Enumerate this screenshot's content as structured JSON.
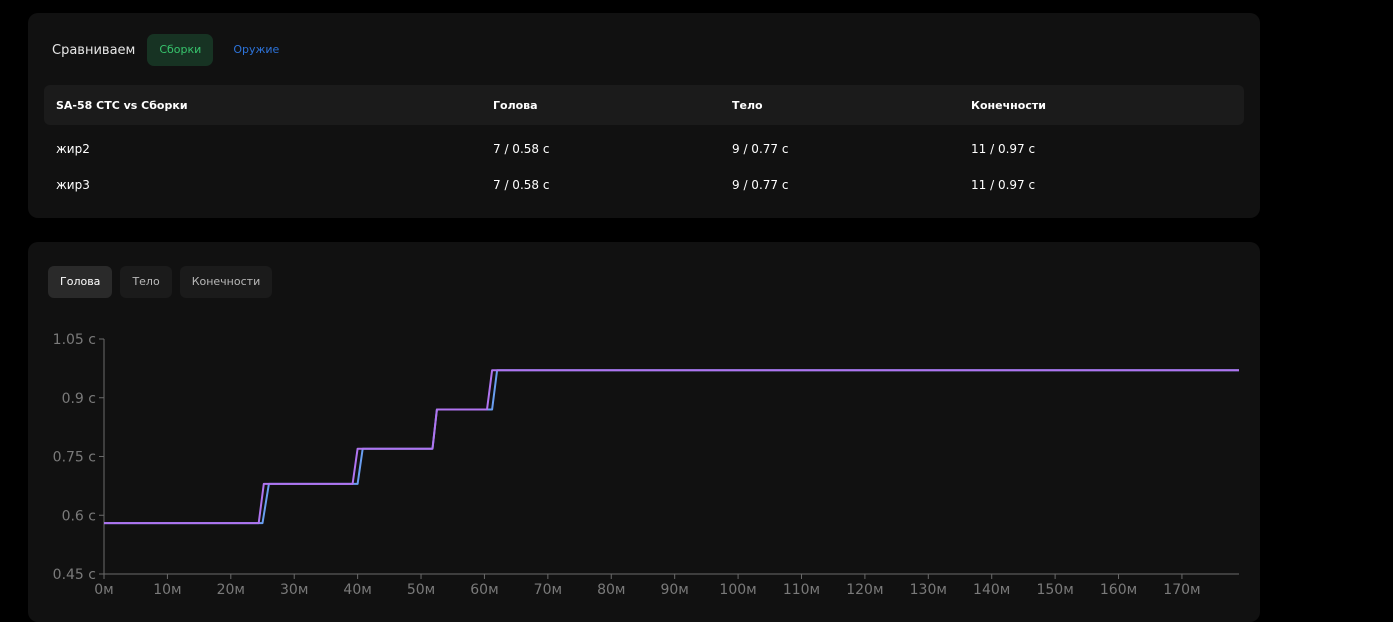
{
  "compare": {
    "label": "Сравниваем",
    "tabs": [
      {
        "label": "Сборки",
        "active": true
      },
      {
        "label": "Оружие",
        "active": false
      }
    ]
  },
  "table": {
    "headers": [
      "SA-58 СТС vs Сборки",
      "Голова",
      "Тело",
      "Конечности"
    ],
    "rows": [
      [
        "жир2",
        "7 / 0.58 с",
        "9 / 0.77 с",
        "11 / 0.97 с"
      ],
      [
        "жир3",
        "7 / 0.58 с",
        "9 / 0.77 с",
        "11 / 0.97 с"
      ]
    ]
  },
  "chart_tabs": [
    {
      "label": "Голова",
      "active": true
    },
    {
      "label": "Тело",
      "active": false
    },
    {
      "label": "Конечности",
      "active": false
    }
  ],
  "chart_data": {
    "type": "line",
    "title": "",
    "xlabel": "",
    "ylabel": "",
    "xlim": [
      0,
      179
    ],
    "ylim": [
      0.45,
      1.05
    ],
    "x_ticks": [
      "0м",
      "10м",
      "20м",
      "30м",
      "40м",
      "50м",
      "60м",
      "70м",
      "80м",
      "90м",
      "100м",
      "110м",
      "120м",
      "130м",
      "140м",
      "150м",
      "160м",
      "170м"
    ],
    "y_ticks": [
      "0.45 с",
      "0.6 с",
      "0.75 с",
      "0.9 с",
      "1.05 с"
    ],
    "y_tick_values": [
      0.45,
      0.6,
      0.75,
      0.9,
      1.05
    ],
    "series": [
      {
        "color": "#6a9ef0",
        "points": [
          [
            0,
            0.58
          ],
          [
            25,
            0.58
          ],
          [
            26,
            0.68
          ],
          [
            40,
            0.68
          ],
          [
            40.8,
            0.77
          ],
          [
            51.8,
            0.77
          ],
          [
            52.5,
            0.87
          ],
          [
            61.2,
            0.87
          ],
          [
            62,
            0.97
          ],
          [
            179,
            0.97
          ]
        ]
      },
      {
        "color": "#b074f0",
        "points": [
          [
            0,
            0.58
          ],
          [
            24.4,
            0.58
          ],
          [
            25.2,
            0.68
          ],
          [
            39.2,
            0.68
          ],
          [
            40,
            0.77
          ],
          [
            51.8,
            0.77
          ],
          [
            52.5,
            0.87
          ],
          [
            60.4,
            0.87
          ],
          [
            61.2,
            0.97
          ],
          [
            179,
            0.97
          ]
        ]
      }
    ]
  }
}
